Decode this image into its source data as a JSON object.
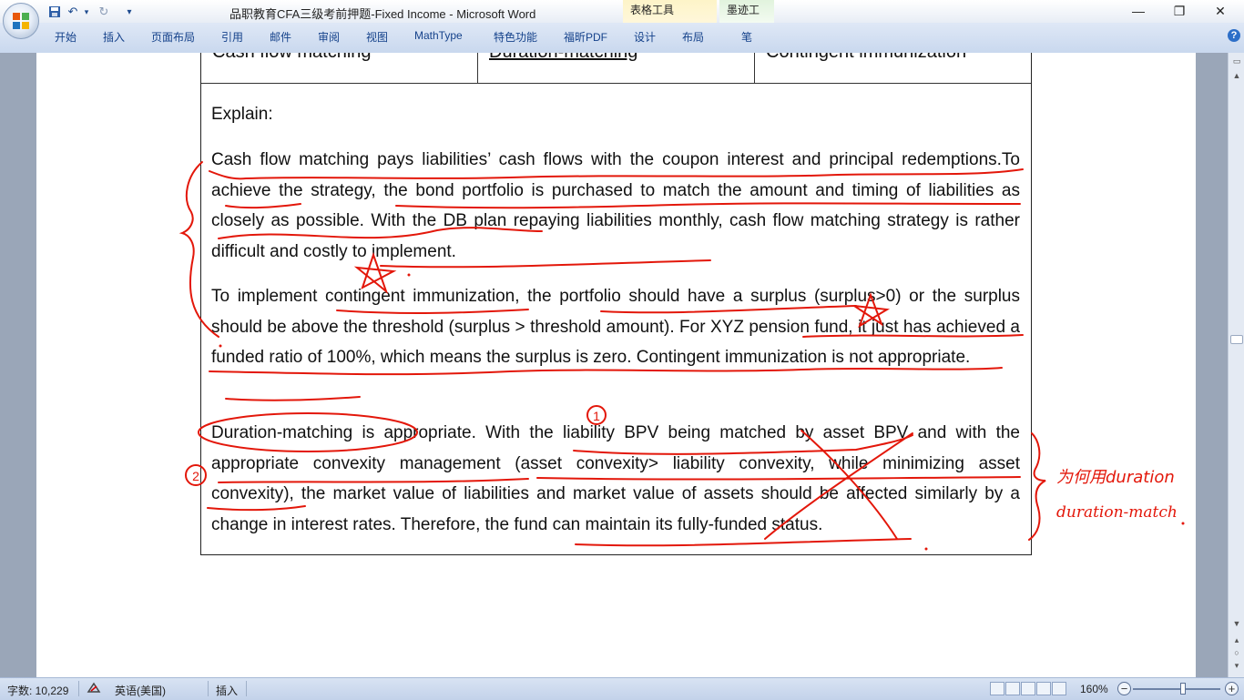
{
  "window": {
    "title": "品职教育CFA三级考前押题-Fixed Income - Microsoft Word",
    "context_tabs": {
      "table_tools": "表格工具",
      "ink_tools": "墨迹工具"
    },
    "controls": {
      "minimize": "—",
      "restore": "❐",
      "close": "✕"
    }
  },
  "qat": {
    "save_icon": "save-icon",
    "undo": "↶",
    "redo": "↻",
    "customize": "▾"
  },
  "ribbon": {
    "tabs": [
      "开始",
      "插入",
      "页面布局",
      "引用",
      "邮件",
      "审阅",
      "视图",
      "MathType",
      "特色功能",
      "福昕PDF",
      "设计",
      "布局",
      "笔"
    ],
    "help": "?"
  },
  "document": {
    "table_header": [
      "Cash flow matching",
      "Duration-matching",
      "Contingent immunization"
    ],
    "explain_label": "Explain:",
    "paragraphs": [
      "Cash flow matching pays liabilities’ cash flows with the coupon interest and principal redemptions.To achieve the strategy, the bond portfolio is purchased to match the amount and timing of liabilities as closely as possible. With the DB plan repaying liabilities monthly, cash flow matching strategy is rather difficult and costly to implement.",
      "To implement contingent immunization, the portfolio should have a surplus (surplus>0) or the surplus should be above the threshold (surplus > threshold amount). For XYZ pension fund, it just has achieved a funded ratio of 100%, which means the surplus is zero. Contingent immunization is not appropriate.",
      "Duration-matching is appropriate. With the liability BPV being matched by asset BPV and with the appropriate convexity management (asset convexity> liability convexity, while minimizing asset convexity), the market value of liabilities and market value of assets should be affected similarly by a change in interest rates. Therefore, the fund can maintain its fully-funded status."
    ],
    "handwriting": {
      "marker_1": "1",
      "marker_2": "2",
      "note_line1": "为何用duration",
      "note_line2": "duration-match",
      "color": "#e3170a"
    }
  },
  "statusbar": {
    "word_count": "字数: 10,229",
    "language": "英语(美国)",
    "mode": "插入",
    "zoom": "160%",
    "zoom_level": 160
  }
}
